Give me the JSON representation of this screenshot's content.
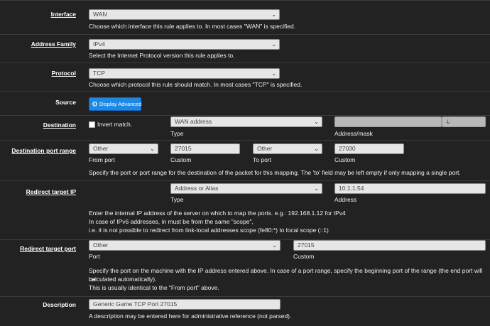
{
  "interface": {
    "label": "Interface",
    "value": "WAN",
    "help": "Choose which interface this rule applies to. In most cases \"WAN\" is specified."
  },
  "address_family": {
    "label": "Address Family",
    "value": "IPv4",
    "help": "Select the Internet Protocol version this rule applies to."
  },
  "protocol": {
    "label": "Protocol",
    "value": "TCP",
    "help": "Choose which protocol this rule should match. In most cases \"TCP\" is specified."
  },
  "source": {
    "label": "Source",
    "button_label": "Display Advanced",
    "button_icon": "gear-icon"
  },
  "destination": {
    "label": "Destination",
    "invert_label": "Invert match.",
    "invert_checked": false,
    "type_value": "WAN address",
    "type_sub": "Type",
    "address_value": "",
    "mask_value": "",
    "mask_sep": "/",
    "address_sub": "Address/mask"
  },
  "dest_port_range": {
    "label": "Destination port range",
    "from_select": "Other",
    "from_sub": "From port",
    "from_custom": "27015",
    "from_custom_sub": "Custom",
    "to_select": "Other",
    "to_sub": "To port",
    "to_custom": "27030",
    "to_custom_sub": "Custom",
    "help": "Specify the port or port range for the destination of the packet for this mapping. The 'to' field may be left empty if only mapping a single port."
  },
  "redirect_ip": {
    "label": "Redirect target IP",
    "type_value": "Address or Alias",
    "type_sub": "Type",
    "address_value": "10.1.1.54",
    "address_sub": "Address",
    "help_1": "Enter the internal IP address of the server on which to map the ports. e.g.: 192.168.1.12 for IPv4",
    "help_2": "In case of IPv6 addresses, in must be from the same \"scope\",",
    "help_3": "i.e. it is not possible to redirect from link-local addresses scope (fe80:*) to local scope (::1)"
  },
  "redirect_port": {
    "label": "Redirect target port",
    "port_select": "Other",
    "port_sub": "Port",
    "custom_value": "27015",
    "custom_sub": "Custom",
    "help_1": "Specify the port on the machine with the IP address entered above. In case of a port range, specify the beginning port of the range (the end port will be",
    "help_2": "calculated automatically).",
    "help_3": "This is usually identical to the \"From port\" above."
  },
  "description": {
    "label": "Description",
    "value": "Generic Game TCP Port 27015",
    "help": "A description may be entered here for administrative reference (not parsed)."
  }
}
